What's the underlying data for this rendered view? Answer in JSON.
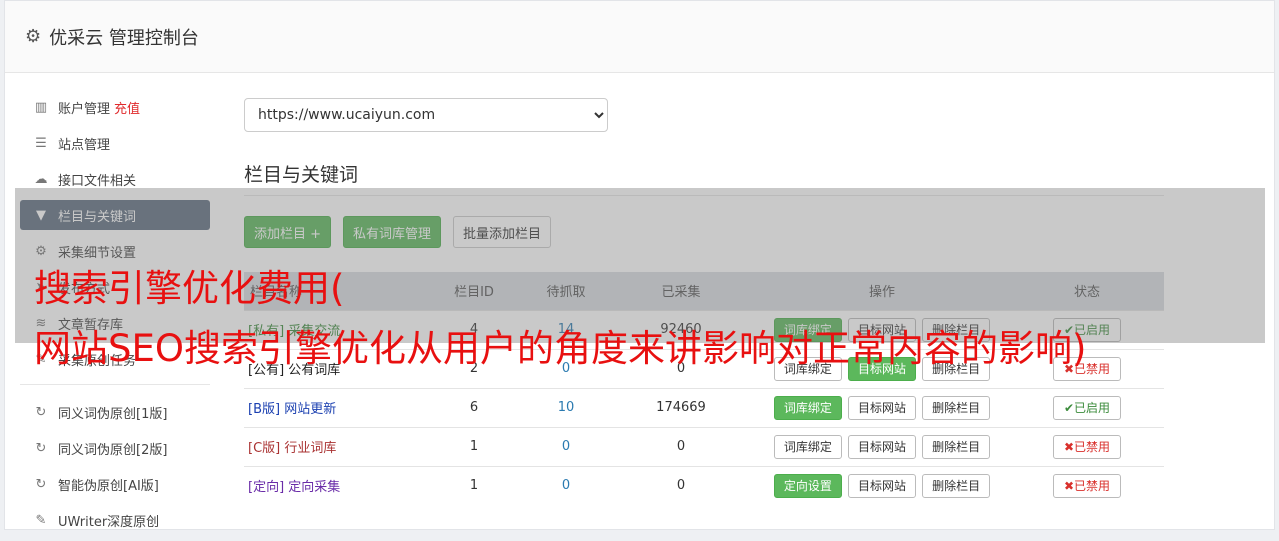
{
  "app": {
    "title": "优采云 管理控制台",
    "icon": "gear-icon"
  },
  "sidebar": {
    "items": [
      {
        "label": "账户管理",
        "extra": "充值",
        "icon": "bar-chart-icon"
      },
      {
        "label": "站点管理",
        "icon": "server-icon"
      },
      {
        "label": "接口文件相关",
        "icon": "cloud-upload-icon"
      },
      {
        "label": "栏目与关键词",
        "icon": "filter-icon",
        "active": true
      },
      {
        "label": "采集细节设置",
        "icon": "cogs-icon"
      },
      {
        "label": "发布方式",
        "icon": "send-icon"
      },
      {
        "label": "文章暂存库",
        "icon": "database-icon"
      },
      {
        "label": "采集原创任务",
        "icon": "edit-icon"
      }
    ],
    "items2": [
      {
        "label": "同义词伪原创[1版]",
        "icon": "refresh-icon"
      },
      {
        "label": "同义词伪原创[2版]",
        "icon": "refresh-icon"
      },
      {
        "label": "智能伪原创[AI版]",
        "icon": "refresh-icon"
      },
      {
        "label": "UWriter深度原创",
        "icon": "pencil-icon"
      }
    ]
  },
  "main": {
    "site_select": {
      "value": "https://www.ucaiyun.com"
    },
    "section_title": "栏目与关键词",
    "buttons": {
      "add": "添加栏目 +",
      "private_lib": "私有词库管理",
      "batch_add": "批量添加栏目"
    },
    "table": {
      "headers": [
        "栏目名称",
        "栏目ID",
        "待抓取",
        "已采集",
        "操作",
        "状态"
      ],
      "rows": [
        {
          "tag": "[私有]",
          "name": "采集交流",
          "id": "4",
          "pending": "14",
          "collected": "92460",
          "op1": "词库绑定",
          "op2": "目标网站",
          "op3": "删除栏目",
          "status": "已启用"
        },
        {
          "tag": "[公有]",
          "name": "公有词库",
          "id": "2",
          "pending": "0",
          "collected": "0",
          "op1": "词库绑定",
          "op2": "目标网站",
          "op3": "删除栏目",
          "status": "已禁用"
        },
        {
          "tag": "[B版]",
          "name": "网站更新",
          "id": "6",
          "pending": "10",
          "collected": "174669",
          "op1": "词库绑定",
          "op2": "目标网站",
          "op3": "删除栏目",
          "status": "已启用"
        },
        {
          "tag": "[C版]",
          "name": "行业词库",
          "id": "1",
          "pending": "0",
          "collected": "0",
          "op1": "词库绑定",
          "op2": "目标网站",
          "op3": "删除栏目",
          "status": "已禁用"
        },
        {
          "tag": "[定向]",
          "name": "定向采集",
          "id": "1",
          "pending": "0",
          "collected": "0",
          "op1": "定向设置",
          "op2": "目标网站",
          "op3": "删除栏目",
          "status": "已禁用"
        }
      ]
    }
  },
  "overlay": {
    "line1": "搜索引擎优化费用(",
    "line2": "网站SEO搜索引擎优化从用户的角度来讲影响对正常内容的影响)"
  },
  "colors": {
    "accent_green": "#5cb85c",
    "active_nav": "#5f6e80",
    "headline_red": "#e81010",
    "recharge_red": "#e0292b"
  }
}
